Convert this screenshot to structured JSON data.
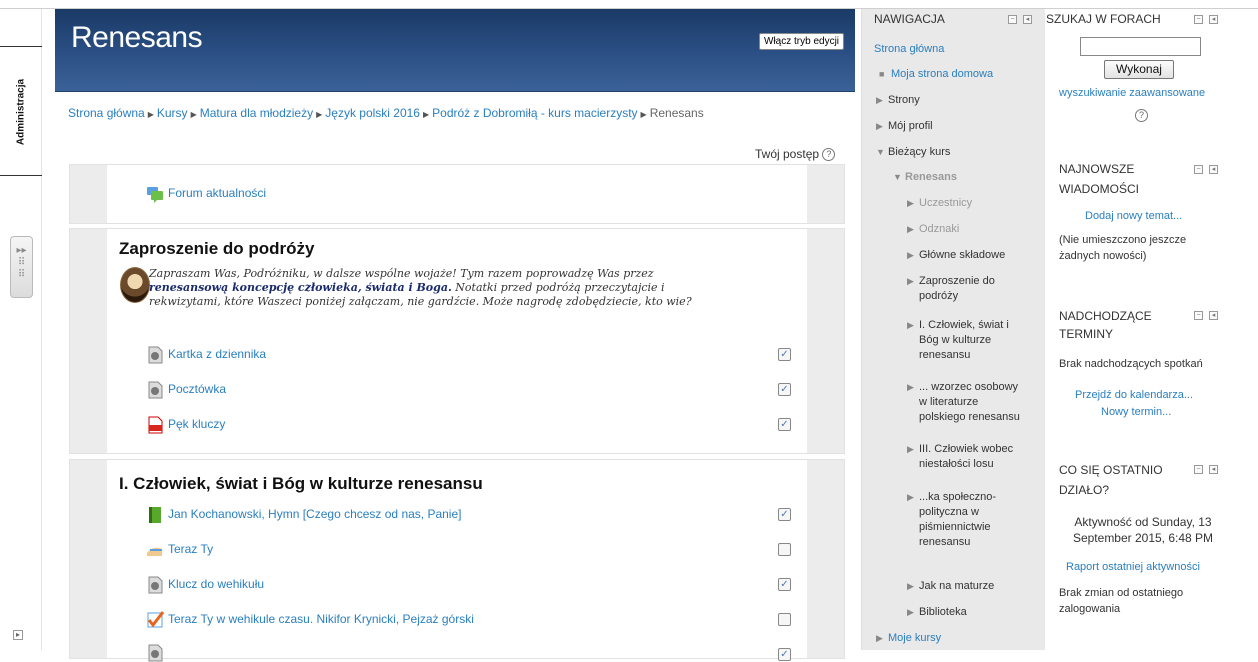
{
  "dock": {
    "tab_label": "Administracja"
  },
  "header": {
    "title": "Renesans",
    "edit_button": "Włącz tryb edycji"
  },
  "breadcrumb": [
    "Strona główna",
    "Kursy",
    "Matura dla młodzieży",
    "Język polski 2016",
    "Podróż z Dobromiłą - kurs macierzysty",
    "Renesans"
  ],
  "progress": {
    "label": "Twój postęp"
  },
  "section0": {
    "forum": "Forum aktualności"
  },
  "section1": {
    "title": "Zaproszenie do podróży",
    "summary_1": "Zapraszam Was, Podróżniku, w dalsze wspólne wojaże! Tym razem poprowadzę Was przez",
    "summary_bold": "renesansową koncepcję człowieka, świata i Boga.",
    "summary_2": "Notatki przed podróżą przeczytajcie i",
    "summary_3": "rekwizytami, które Waszeci poniżej załączam, nie gardźcie. Może nagrodę zdobędziecie, kto wie?",
    "activities": [
      {
        "label": "Kartka z dziennika",
        "icon": "file-icon",
        "done": true
      },
      {
        "label": "Pocztówka",
        "icon": "file-icon",
        "done": true
      },
      {
        "label": "Pęk kluczy",
        "icon": "pdf-icon",
        "done": true
      }
    ]
  },
  "section2": {
    "title": "I. Człowiek, świat i Bóg w kulturze renesansu",
    "activities": [
      {
        "label": "Jan Kochanowski, Hymn [Czego chcesz od nas, Panie]",
        "icon": "book-icon",
        "done": true
      },
      {
        "label": "Teraz Ty",
        "icon": "assignment-icon",
        "done": false
      },
      {
        "label": "Klucz do wehikułu",
        "icon": "file-icon",
        "done": true
      },
      {
        "label": "Teraz Ty w wehikule czasu. Nikifor Krynicki, Pejzaż górski",
        "icon": "quiz-icon",
        "done": false
      }
    ]
  },
  "navigation": {
    "title": "Nawigacja",
    "home": "Strona główna",
    "my_home": "Moja strona domowa",
    "pages": "Strony",
    "profile": "Mój profil",
    "current_course": "Bieżący kurs",
    "course": "Renesans",
    "participants": "Uczestnicy",
    "badges": "Odznaki",
    "items": [
      {
        "lines": [
          "Główne składowe"
        ]
      },
      {
        "lines": [
          "Zaproszenie do",
          "podróży"
        ]
      },
      {
        "lines": [
          "I. Człowiek, świat i",
          "Bóg w kulturze",
          "renesansu"
        ]
      },
      {
        "lines": [
          "... wzorzec osobowy",
          "w literaturze",
          "polskiego renesansu"
        ]
      },
      {
        "lines": [
          "III. Człowiek wobec",
          "niestałości losu"
        ]
      },
      {
        "lines": [
          "...ka społeczno-",
          "polityczna w",
          "piśmiennictwie",
          "renesansu"
        ]
      },
      {
        "lines": [
          "Jak na maturze"
        ]
      },
      {
        "lines": [
          "Biblioteka"
        ]
      }
    ],
    "my_courses": "Moje kursy"
  },
  "forum_search": {
    "title": "Szukaj w forach",
    "button": "Wykonaj",
    "advanced": "wyszukiwanie zaawansowane"
  },
  "news": {
    "title_1": "Najnowsze",
    "title_2": "wiadomości",
    "add": "Dodaj nowy temat...",
    "empty_1": "(Nie umieszczono jeszcze",
    "empty_2": "żadnych nowości)"
  },
  "events": {
    "title_1": "Nadchodzące",
    "title_2": "terminy",
    "empty": "Brak nadchodzących spotkań",
    "calendar": "Przejdź do kalendarza...",
    "new_event": "Nowy termin..."
  },
  "recent": {
    "title_1": "Co się ostatnio",
    "title_2": "działo?",
    "since_1": "Aktywność od Sunday, 13",
    "since_2": "September 2015, 6:48 PM",
    "report": "Raport ostatniej aktywności",
    "none_1": "Brak zmian od ostatniego",
    "none_2": "zalogowania"
  }
}
